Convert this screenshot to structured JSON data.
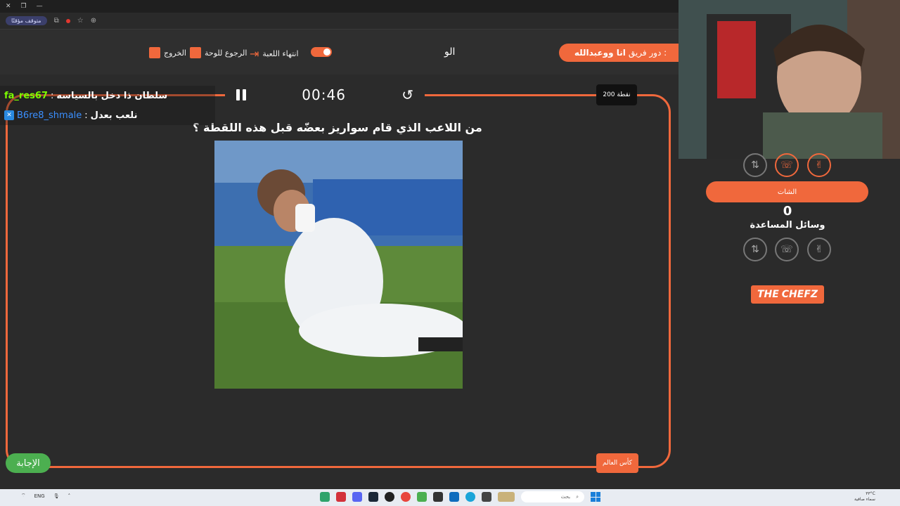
{
  "browser": {
    "tab_chip": "متوقف مؤقتًا",
    "address": "⊕"
  },
  "nav": {
    "exit_label": "الخروج",
    "back_label": "الرجوع للوحة",
    "end_game_label": "انتهاء اللعبة",
    "center_word": "الو",
    "turn_prefix": "دور فريق :",
    "turn_team": "انا ووعبدالله"
  },
  "board": {
    "points": "200 نقطة",
    "timer": "00:46",
    "question": "من اللاعب الذي قام سواريز بعضّه قبل هذه اللقطة ؟",
    "answer_label": "الإجابة",
    "category": "كأس العالم"
  },
  "chat": {
    "messages": [
      {
        "user": "fa_res67",
        "sep": ":",
        "text": "سلطان ذا دخل بالسياسه"
      },
      {
        "user": "B6re8_shmale",
        "sep": ":",
        "text": "نلعب بعدل"
      }
    ]
  },
  "panel": {
    "chat_button": "الشات",
    "help_count": "0",
    "help_title": "وسائل المساعدة",
    "logo_the": "THE",
    "logo_chefz": "CHEFZ"
  },
  "taskbar": {
    "lang": "ENG",
    "search_placeholder": "بحث",
    "temp": "٣٣°C",
    "weather": "سماء صافية"
  },
  "colors": {
    "accent": "#f0683c",
    "answer_green": "#4caf50",
    "chat_user1": "#7cfc00",
    "chat_user2": "#3a8fff"
  }
}
